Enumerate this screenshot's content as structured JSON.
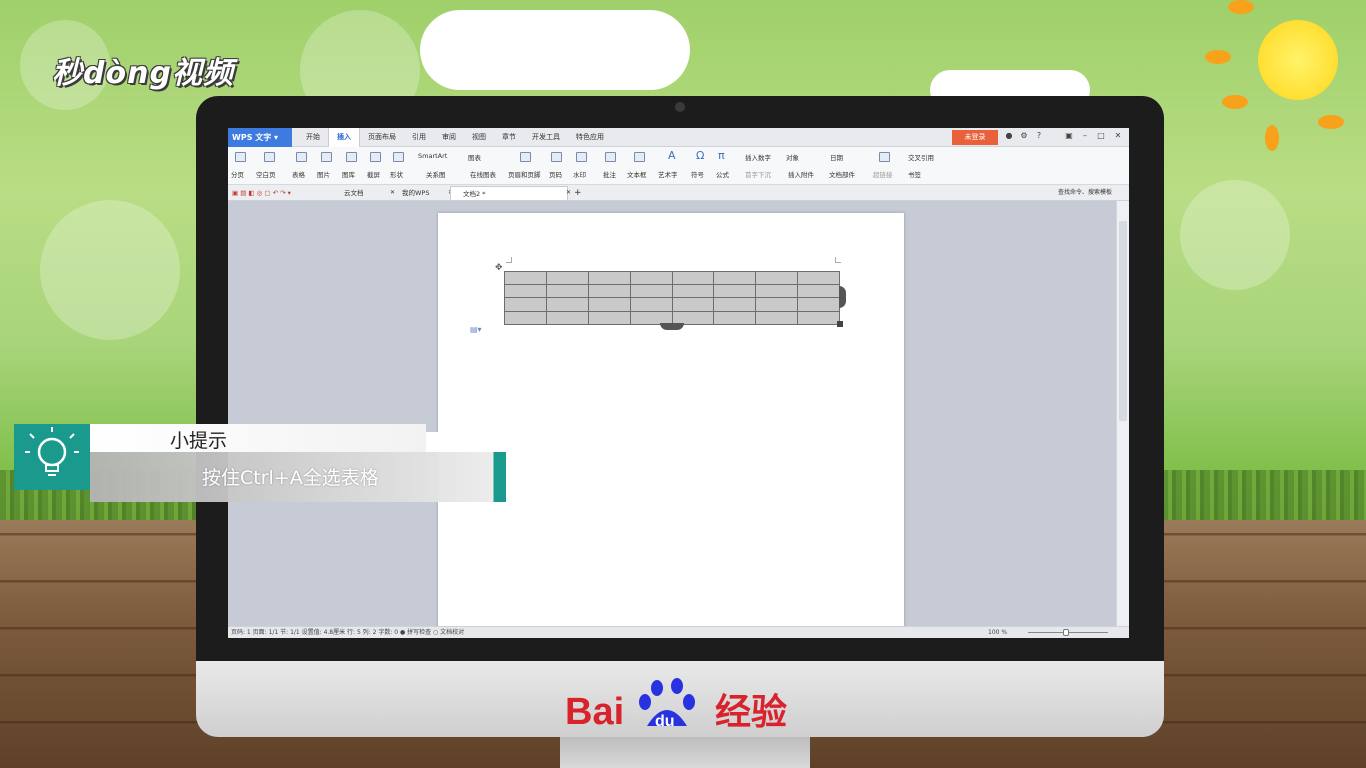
{
  "brand": {
    "logo_text": "秒dòng视频"
  },
  "app": {
    "app_name": "WPS 文字",
    "menu_tabs": [
      "开始",
      "插入",
      "页面布局",
      "引用",
      "审阅",
      "视图",
      "章节",
      "开发工具",
      "特色应用"
    ],
    "active_tab": "插入",
    "login_label": "未登录"
  },
  "ribbon": {
    "page_break": "分页",
    "blank_page": "空白页",
    "table": "表格",
    "picture": "图片",
    "gallery": "图库",
    "screenshot": "截屏",
    "shapes": "形状",
    "smartart": "SmartArt",
    "chart": "图表",
    "relation_chart": "关系图",
    "online_chart": "在线图表",
    "header_footer": "页眉和页脚",
    "page_number": "页码",
    "watermark": "水印",
    "comment": "批注",
    "textbox": "文本框",
    "wordart": "艺术字",
    "symbol": "符号",
    "formula": "公式",
    "insert_number": "插入数字",
    "object": "对象",
    "drop_cap": "首字下沉",
    "attachment": "插入附件",
    "date": "日期",
    "doc_part": "文档部件",
    "hyperlink": "超链接",
    "cross_ref": "交叉引用",
    "bookmark": "书签"
  },
  "doc_tabs": {
    "cloud_docs": "云文档",
    "my_wps": "我的WPS",
    "doc2": "文档2 *",
    "search_placeholder": "查找命令、搜索模板"
  },
  "status": {
    "left": "页码: 1   页面: 1/1   节: 1/1   设置值: 4.8厘米  行: 5   列: 2   字数: 0   ● 拼写检查  ○ 文档校对",
    "zoom": "100 %"
  },
  "table": {
    "rows": 4,
    "cols": 8
  },
  "tip": {
    "title": "小提示",
    "body": "按住Ctrl+A全选表格"
  },
  "footer": {
    "baidu_text": "Bai",
    "baidu_du": "du",
    "baidu_jingyan": "经验"
  },
  "colors": {
    "accent_blue": "#3d7be0",
    "login_orange": "#e8613a",
    "tip_teal": "#1a9a8c",
    "baidu_red": "#d9232c",
    "baidu_blue": "#2932e1"
  }
}
